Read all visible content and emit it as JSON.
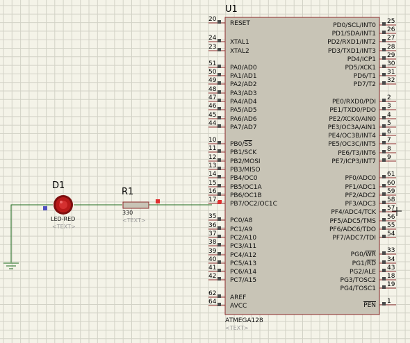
{
  "colors": {
    "background": "#f4f3e8",
    "grid": "#d2d2c6",
    "chip_fill": "#c8c4b6",
    "chip_border": "#8b2a2a",
    "wire": "#1d6b1d",
    "led": "#b81a1a",
    "pin_marker": "#4a4a4a",
    "red_marker": "#e03030",
    "blue_marker": "#5050c0"
  },
  "chip": {
    "ref": "U1",
    "part": "ATMEGA128",
    "text_placeholder": "<TEXT>",
    "left_pins": [
      {
        "num": "20",
        "label": "RESET"
      },
      {
        "num": "24",
        "label": "XTAL1"
      },
      {
        "num": "23",
        "label": "XTAL2"
      },
      {
        "num": "51",
        "label": "PA0/AD0"
      },
      {
        "num": "50",
        "label": "PA1/AD1"
      },
      {
        "num": "49",
        "label": "PA2/AD2"
      },
      {
        "num": "48",
        "label": "PA3/AD3"
      },
      {
        "num": "47",
        "label": "PA4/AD4"
      },
      {
        "num": "46",
        "label": "PA5/AD5"
      },
      {
        "num": "45",
        "label": "PA6/AD6"
      },
      {
        "num": "44",
        "label": "PA7/AD7"
      },
      {
        "num": "10",
        "label": "PB0/SS"
      },
      {
        "num": "11",
        "label": "PB1/SCK"
      },
      {
        "num": "12",
        "label": "PB2/MOSI"
      },
      {
        "num": "13",
        "label": "PB3/MISO"
      },
      {
        "num": "14",
        "label": "PB4/OC0"
      },
      {
        "num": "15",
        "label": "PB5/OC1A"
      },
      {
        "num": "16",
        "label": "PB6/OC1B"
      },
      {
        "num": "17",
        "label": "PB7/OC2/OC1C"
      },
      {
        "num": "35",
        "label": "PC0/A8"
      },
      {
        "num": "36",
        "label": "PC1/A9"
      },
      {
        "num": "37",
        "label": "PC2/A10"
      },
      {
        "num": "38",
        "label": "PC3/A11"
      },
      {
        "num": "39",
        "label": "PC4/A12"
      },
      {
        "num": "40",
        "label": "PC5/A13"
      },
      {
        "num": "41",
        "label": "PC6/A14"
      },
      {
        "num": "42",
        "label": "PC7/A15"
      },
      {
        "num": "62",
        "label": "AREF"
      },
      {
        "num": "64",
        "label": "AVCC"
      }
    ],
    "right_pins": [
      {
        "num": "25",
        "label": "PD0/SCL/INT0"
      },
      {
        "num": "26",
        "label": "PD1/SDA/INT1"
      },
      {
        "num": "27",
        "label": "PD2/RXD1/INT2"
      },
      {
        "num": "28",
        "label": "PD3/TXD1/INT3"
      },
      {
        "num": "29",
        "label": "PD4/ICP1"
      },
      {
        "num": "30",
        "label": "PD5/XCK1"
      },
      {
        "num": "31",
        "label": "PD6/T1"
      },
      {
        "num": "32",
        "label": "PD7/T2"
      },
      {
        "num": "2",
        "label": "PE0/RXD0/PDI"
      },
      {
        "num": "3",
        "label": "PE1/TXD0/PDO"
      },
      {
        "num": "4",
        "label": "PE2/XCK0/AIN0"
      },
      {
        "num": "5",
        "label": "PE3/OC3A/AIN1"
      },
      {
        "num": "6",
        "label": "PE4/OC3B/INT4"
      },
      {
        "num": "7",
        "label": "PE5/OC3C/INT5"
      },
      {
        "num": "8",
        "label": "PE6/T3/INT6"
      },
      {
        "num": "9",
        "label": "PE7/ICP3/INT7"
      },
      {
        "num": "61",
        "label": "PF0/ADC0"
      },
      {
        "num": "60",
        "label": "PF1/ADC1"
      },
      {
        "num": "59",
        "label": "PF2/ADC2"
      },
      {
        "num": "58",
        "label": "PF3/ADC3"
      },
      {
        "num": "57",
        "label": "PF4/ADC4/TCK"
      },
      {
        "num": "56",
        "label": "PF5/ADC5/TMS"
      },
      {
        "num": "55",
        "label": "PF6/ADC6/TDO"
      },
      {
        "num": "54",
        "label": "PF7/ADC7/TDI"
      },
      {
        "num": "33",
        "label": "PG0/WR"
      },
      {
        "num": "34",
        "label": "PG1/RD"
      },
      {
        "num": "43",
        "label": "PG2/ALE"
      },
      {
        "num": "18",
        "label": "PG3/TOSC2"
      },
      {
        "num": "19",
        "label": "PG4/TOSC1"
      },
      {
        "num": "1",
        "label": "PEN"
      }
    ]
  },
  "led": {
    "ref": "D1",
    "part": "LED-RED",
    "text_placeholder": "<TEXT>"
  },
  "resistor": {
    "ref": "R1",
    "value": "330",
    "text_placeholder": "<TEXT>"
  }
}
